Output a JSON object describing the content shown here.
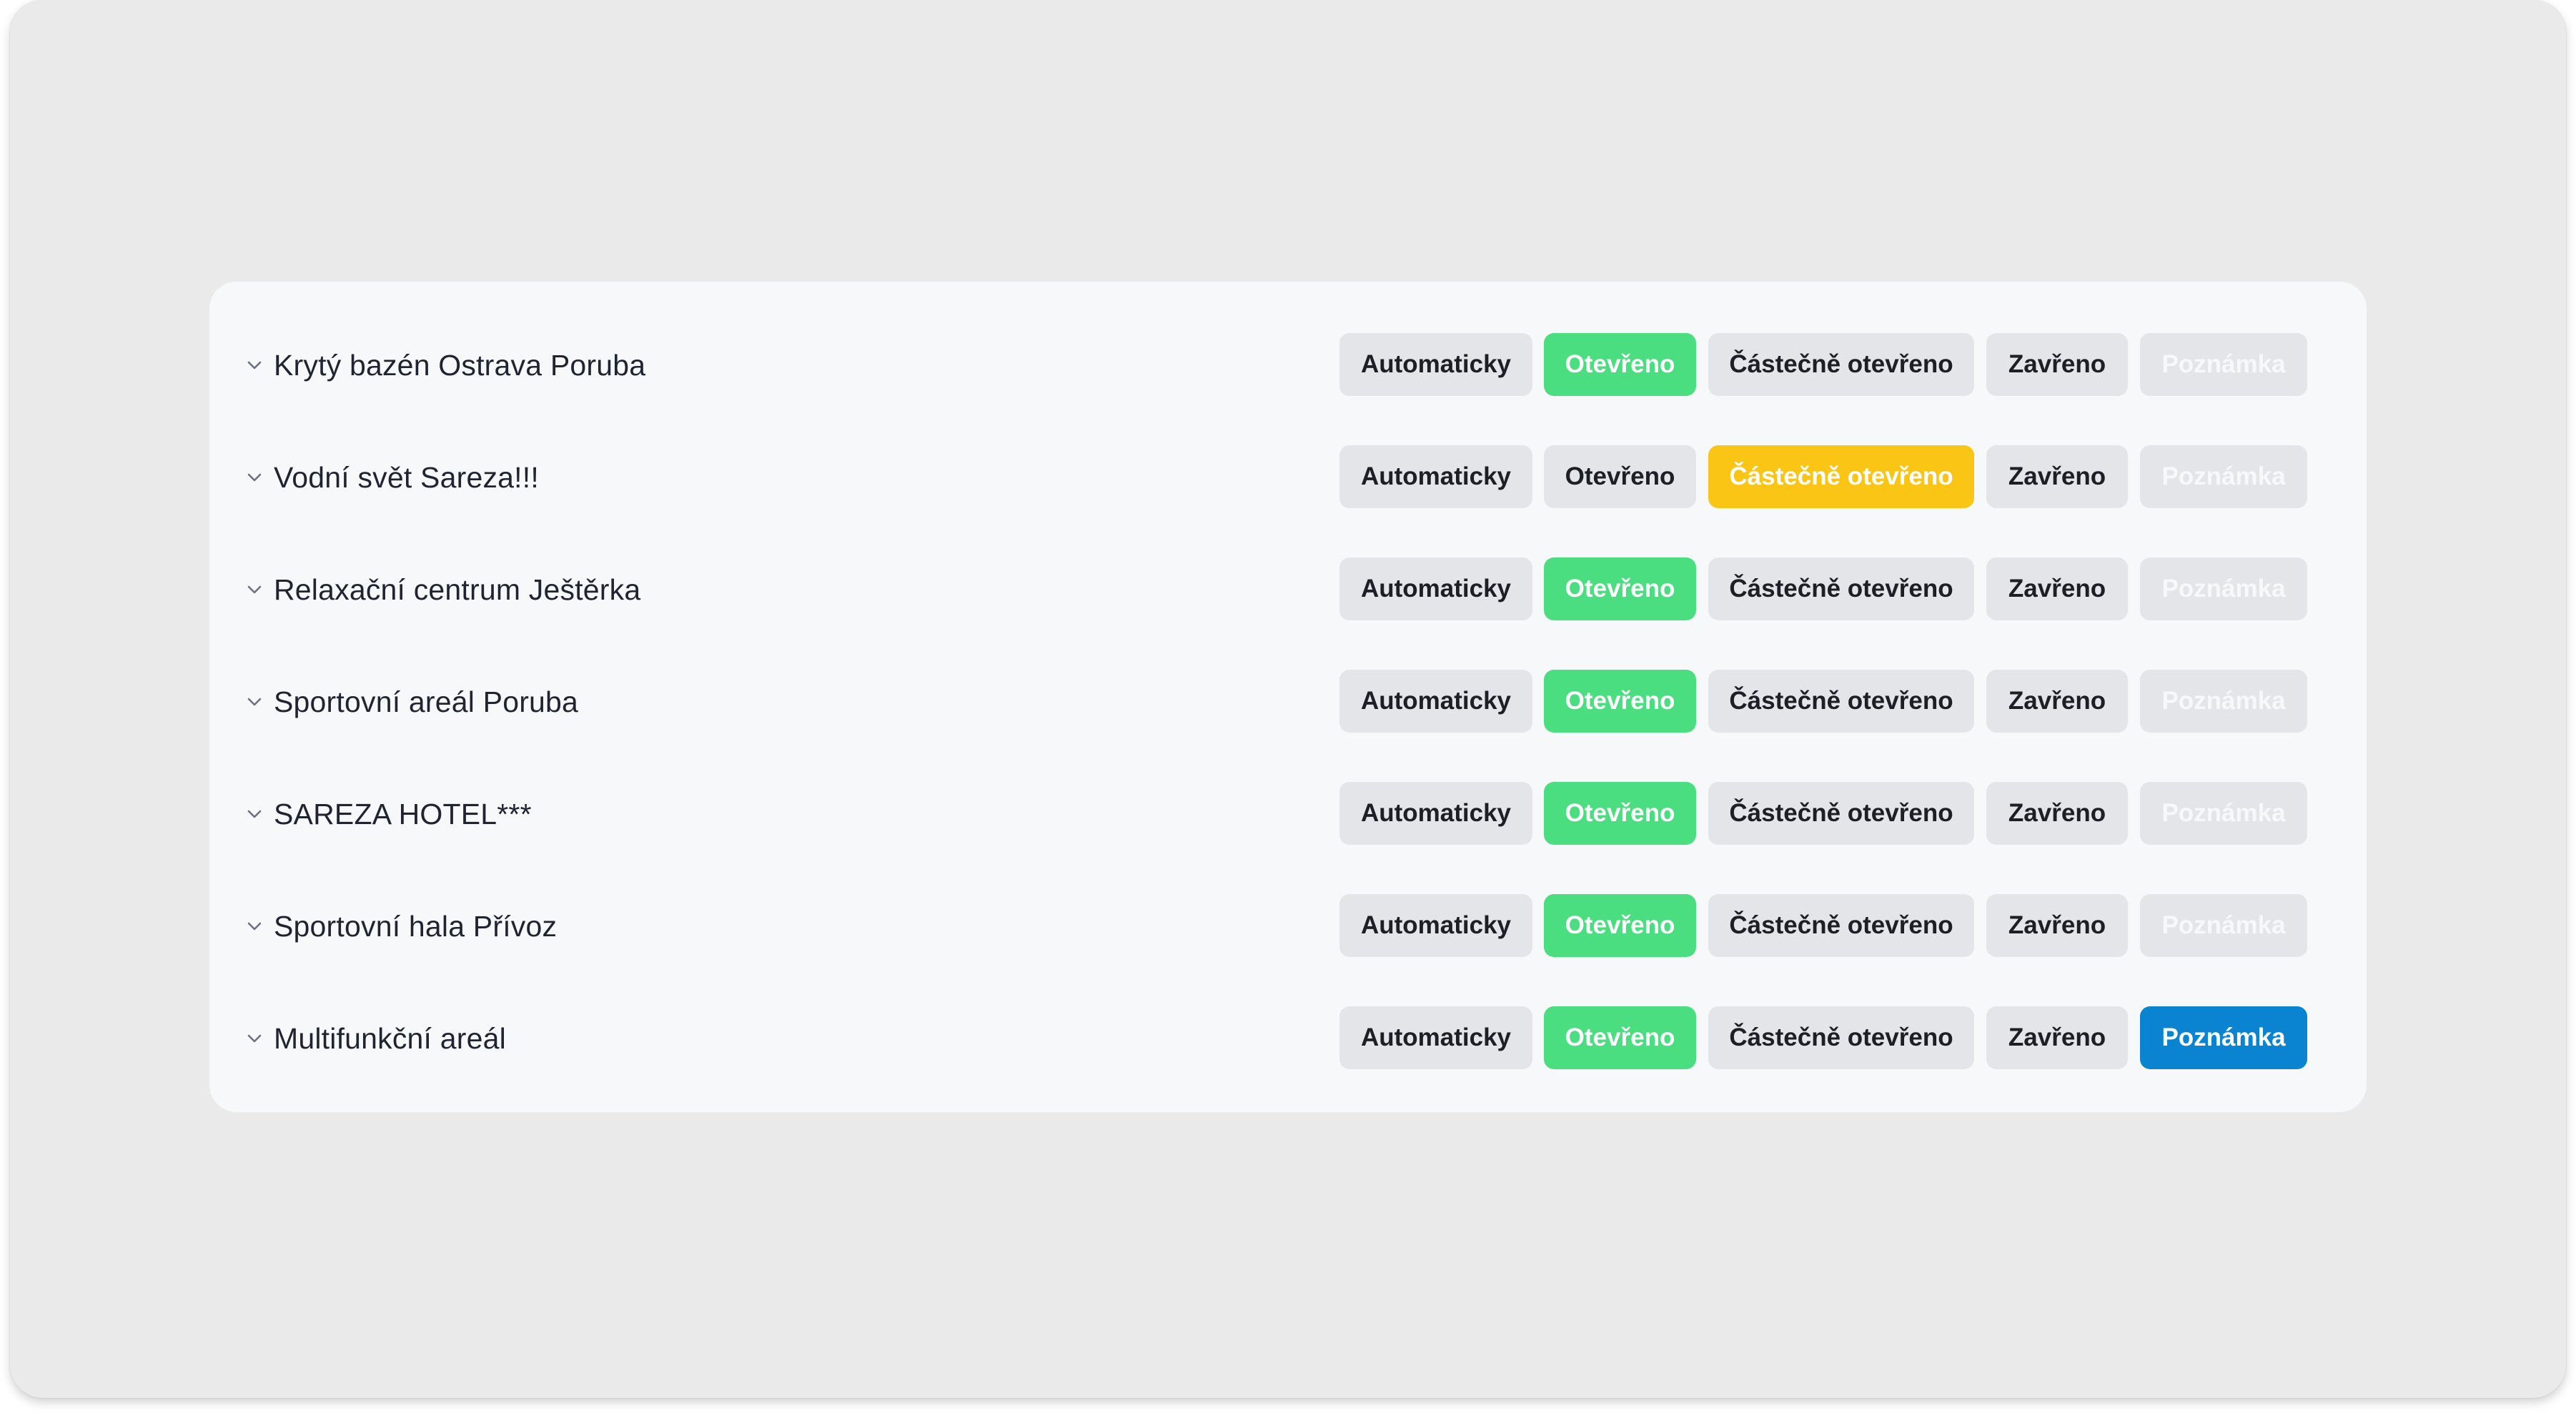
{
  "buttons": {
    "auto": "Automaticky",
    "open": "Otevřeno",
    "partial": "Částečně otevřeno",
    "closed": "Zavřeno",
    "note": "Poznámka"
  },
  "colors": {
    "open_active": "#4ade80",
    "partial_active": "#fac515",
    "note_active": "#0a84d0",
    "inactive": "#e4e5e8"
  },
  "facilities": [
    {
      "name": "Krytý bazén Ostrava Poruba",
      "status": "open",
      "note_active": false
    },
    {
      "name": "Vodní svět Sareza!!!",
      "status": "partial",
      "note_active": false
    },
    {
      "name": "Relaxační centrum Ještěrka",
      "status": "open",
      "note_active": false
    },
    {
      "name": "Sportovní areál Poruba",
      "status": "open",
      "note_active": false
    },
    {
      "name": "SAREZA HOTEL***",
      "status": "open",
      "note_active": false
    },
    {
      "name": "Sportovní hala Přívoz",
      "status": "open",
      "note_active": false
    },
    {
      "name": "Multifunkční areál",
      "status": "open",
      "note_active": true
    }
  ]
}
